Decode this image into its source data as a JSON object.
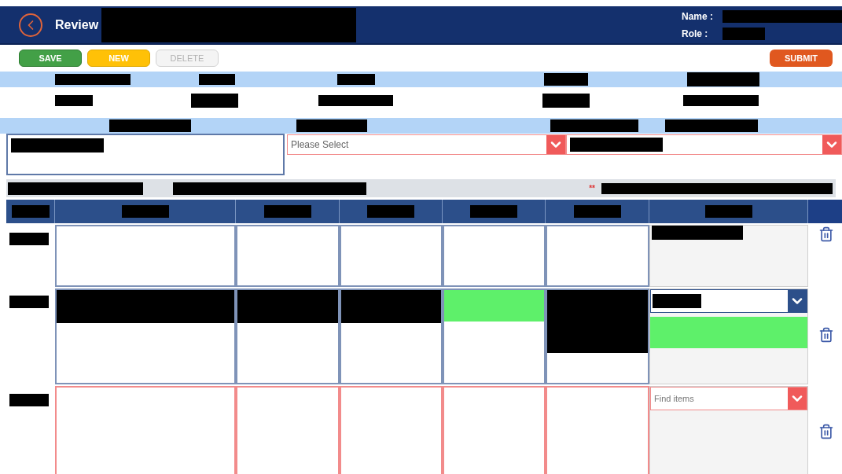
{
  "header": {
    "title": "Review",
    "name_label": "Name :",
    "role_label": "Role :"
  },
  "toolbar": {
    "buttons": [
      {
        "label": "SAVE",
        "kind": "save",
        "disabled": false
      },
      {
        "label": "NEW",
        "kind": "new",
        "disabled": false
      },
      {
        "label": "DELETE",
        "kind": "delete",
        "disabled": true
      }
    ],
    "submit": "SUBMIT"
  },
  "form": {
    "dropdowns": [
      {
        "placeholder": "Please Select",
        "invalid": true
      },
      {
        "invalid": true
      }
    ]
  },
  "section_bar": {
    "required_mark": "**"
  },
  "table": {
    "rows": [
      {
        "invalid": false,
        "cells": [
          {
            "highlighted": false
          },
          {
            "highlighted": false
          },
          {
            "highlighted": false
          },
          {
            "highlighted": false
          },
          {
            "highlighted": false
          }
        ],
        "last_cell": {
          "kind": "text"
        }
      },
      {
        "invalid": false,
        "cells": [
          {
            "highlighted": false
          },
          {
            "highlighted": false
          },
          {
            "highlighted": false
          },
          {
            "highlighted": true
          },
          {
            "highlighted": false
          }
        ],
        "last_cell": {
          "kind": "dropdown",
          "highlighted": true
        }
      },
      {
        "invalid": true,
        "cells": [
          {
            "highlighted": false
          },
          {
            "highlighted": false
          },
          {
            "highlighted": false
          },
          {
            "highlighted": false
          },
          {
            "highlighted": false
          }
        ],
        "last_cell": {
          "kind": "search",
          "placeholder": "Find items"
        }
      }
    ]
  }
}
